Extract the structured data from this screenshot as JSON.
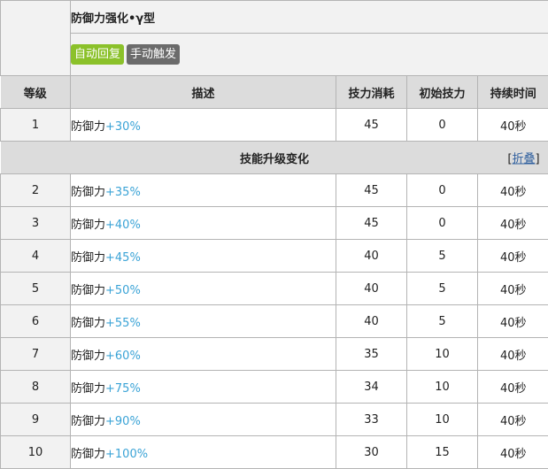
{
  "skill": {
    "name": "防御力强化•γ型",
    "tags": [
      {
        "label": "自动回复",
        "color": "#8bc12a"
      },
      {
        "label": "手动触发",
        "color": "#6b6b6b"
      }
    ]
  },
  "columns": [
    "等级",
    "描述",
    "技力消耗",
    "初始技力",
    "持续时间"
  ],
  "rows": [
    {
      "level": "1",
      "desc_prefix": "防御力",
      "desc_value": "+30%",
      "sp_cost": "45",
      "init_sp": "0",
      "duration": "40秒"
    },
    {
      "level": "2",
      "desc_prefix": "防御力",
      "desc_value": "+35%",
      "sp_cost": "45",
      "init_sp": "0",
      "duration": "40秒"
    },
    {
      "level": "3",
      "desc_prefix": "防御力",
      "desc_value": "+40%",
      "sp_cost": "45",
      "init_sp": "0",
      "duration": "40秒"
    },
    {
      "level": "4",
      "desc_prefix": "防御力",
      "desc_value": "+45%",
      "sp_cost": "40",
      "init_sp": "5",
      "duration": "40秒"
    },
    {
      "level": "5",
      "desc_prefix": "防御力",
      "desc_value": "+50%",
      "sp_cost": "40",
      "init_sp": "5",
      "duration": "40秒"
    },
    {
      "level": "6",
      "desc_prefix": "防御力",
      "desc_value": "+55%",
      "sp_cost": "40",
      "init_sp": "5",
      "duration": "40秒"
    },
    {
      "level": "7",
      "desc_prefix": "防御力",
      "desc_value": "+60%",
      "sp_cost": "35",
      "init_sp": "10",
      "duration": "40秒"
    },
    {
      "level": "8",
      "desc_prefix": "防御力",
      "desc_value": "+75%",
      "sp_cost": "34",
      "init_sp": "10",
      "duration": "40秒"
    },
    {
      "level": "9",
      "desc_prefix": "防御力",
      "desc_value": "+90%",
      "sp_cost": "33",
      "init_sp": "10",
      "duration": "40秒"
    },
    {
      "level": "10",
      "desc_prefix": "防御力",
      "desc_value": "+100%",
      "sp_cost": "30",
      "init_sp": "15",
      "duration": "40秒"
    }
  ],
  "section": {
    "title": "技能升级变化",
    "fold_bracket_open": "[",
    "fold_label": "折叠",
    "fold_bracket_close": "]"
  },
  "colors": {
    "accent_value": "#3aa3d6",
    "header_bg": "#dcdcdc",
    "cell_bg": "#f2f2f2"
  }
}
